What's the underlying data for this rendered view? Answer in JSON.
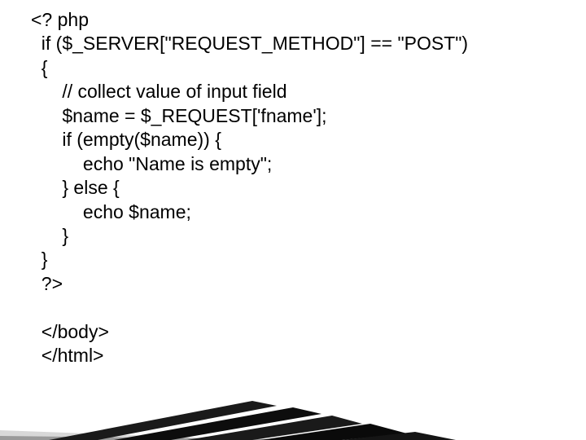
{
  "code": {
    "l1": "<? php",
    "l2": "  if ($_SERVER[\"REQUEST_METHOD\"] == \"POST\")",
    "l3": "  {",
    "l4": "      // collect value of input field",
    "l5": "      $name = $_REQUEST['fname'];",
    "l6": "      if (empty($name)) {",
    "l7": "          echo \"Name is empty\";",
    "l8": "      } else {",
    "l9": "          echo $name;",
    "l10": "      }",
    "l11": "  }",
    "l12": "  ?>",
    "l13": "",
    "l14": "  </body>",
    "l15": "  </html>"
  }
}
